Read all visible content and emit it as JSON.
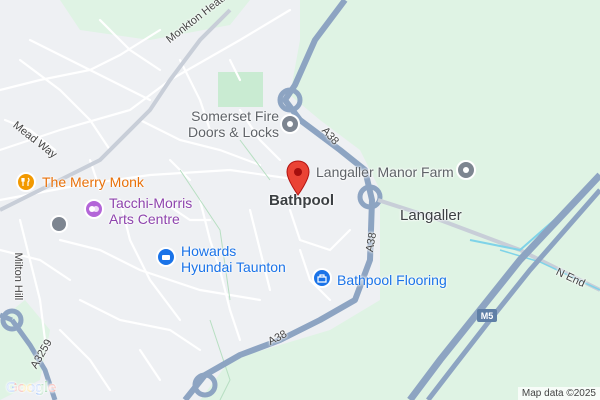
{
  "map": {
    "colors": {
      "background": "#eef0f3",
      "green_area": "#dff3e4",
      "park": "#c9ebd2",
      "motorway": "#8da4c2",
      "water": "#7fd3e8",
      "pin_red": "#ea4335"
    },
    "place_labels": {
      "bathpool": "Bathpool",
      "langaller": "Langaller"
    },
    "pois": {
      "somerset_fire_line1": "Somerset Fire",
      "somerset_fire_line2": "Doors & Locks",
      "langaller_manor": "Langaller Manor Farm",
      "merry_monk": "The Merry Monk",
      "tacchi_line1": "Tacchi-Morris",
      "tacchi_line2": "Arts Centre",
      "howards_line1": "Howards",
      "howards_line2": "Hyundai Taunton",
      "bathpool_flooring": "Bathpool Flooring"
    },
    "roads": {
      "monkton_heathfield": "Monkton Heathfield Rd",
      "mead_way": "Mead Way",
      "milton_hill": "Milton Hill",
      "a38_north": "A38",
      "a38_mid": "A38",
      "a38_south": "A38",
      "a3259": "A3259",
      "n_end": "N End",
      "m5": "M5"
    },
    "icons": {
      "pin": "red-location-pin-icon",
      "poi_generic": "poi-pin-icon",
      "restaurant": "restaurant-icon",
      "theatre": "theatre-icon",
      "car_dealer": "car-dealer-icon",
      "store": "store-icon"
    },
    "google_logo": "Google",
    "attribution": "Map data ©2025"
  }
}
